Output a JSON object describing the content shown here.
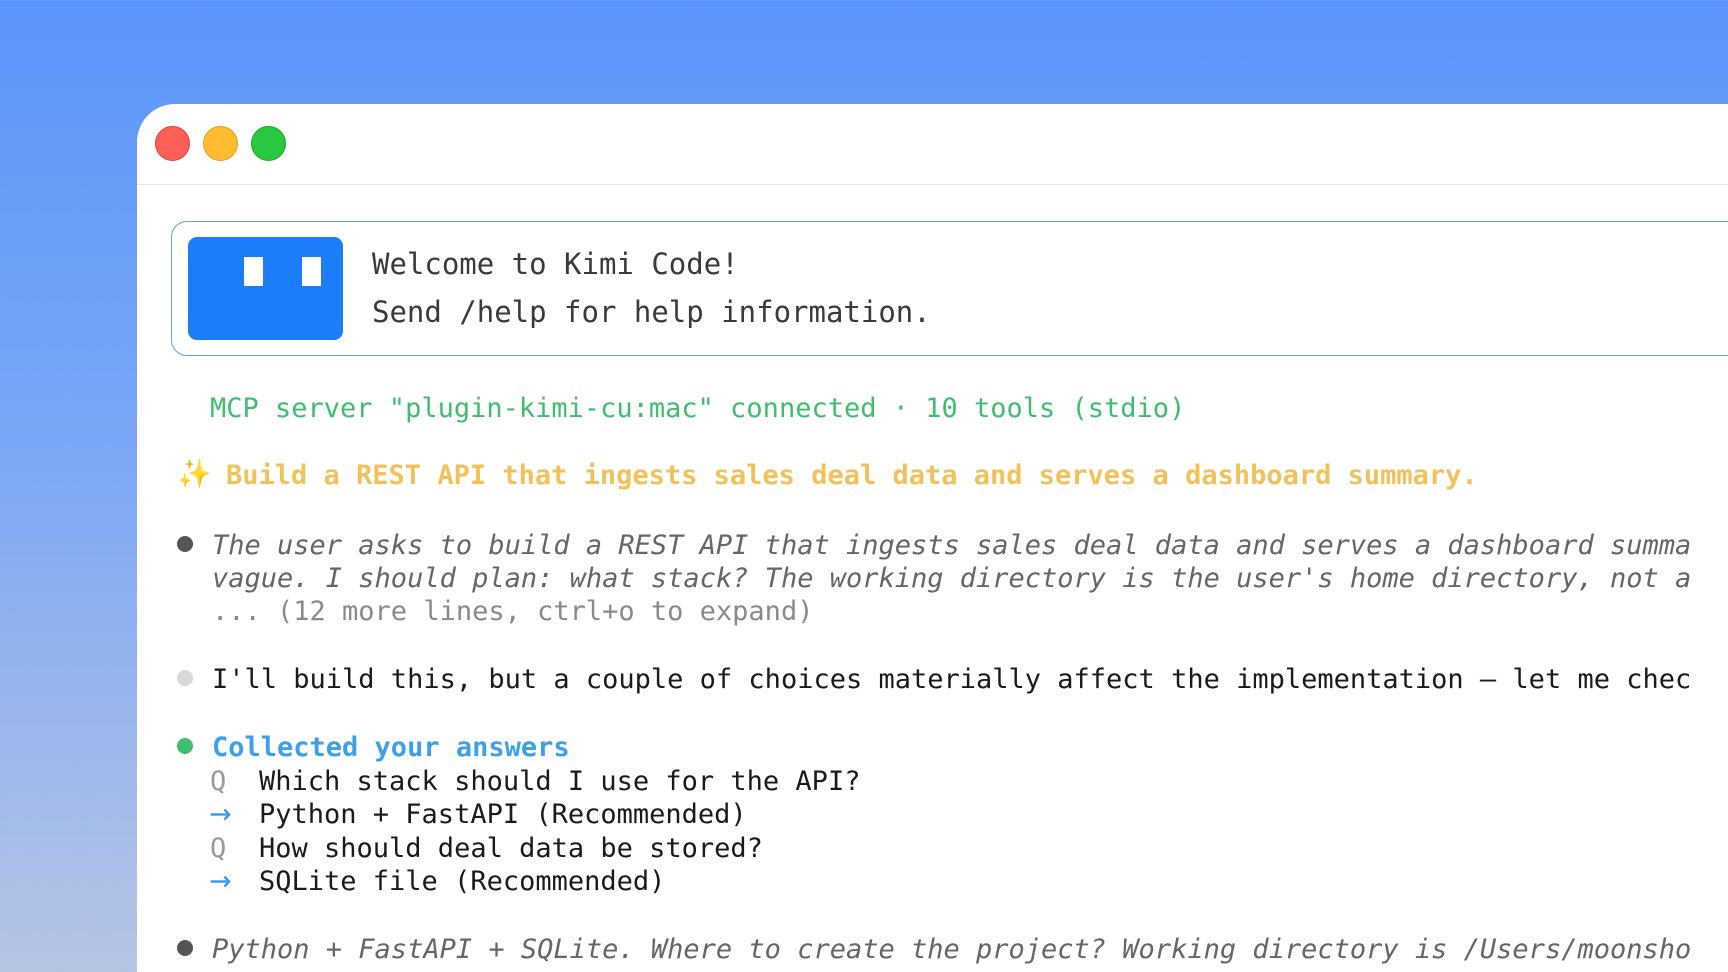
{
  "window": {
    "controls": [
      "close",
      "minimize",
      "zoom"
    ]
  },
  "welcome": {
    "line1": "Welcome to Kimi Code!",
    "line2": "Send /help for help information."
  },
  "mcp_status": "MCP server \"plugin-kimi-cu:mac\" connected · 10 tools (stdio)",
  "prompt": {
    "icon": "✨",
    "text": "Build a REST API that ingests sales deal data and serves a dashboard summary."
  },
  "thinking": {
    "line1": "The user asks to build a REST API that ingests sales deal data and serves a dashboard summa",
    "line2": "vague. I should plan: what stack? The working directory is the user's home directory, not a",
    "more": "... (12 more lines, ctrl+o to expand)"
  },
  "reply": "I'll build this, but a couple of choices materially affect the implementation — let me chec",
  "answers": {
    "title": "Collected your answers",
    "items": [
      {
        "mark": "Q",
        "text": "Which stack should I use for the API?"
      },
      {
        "mark": "→",
        "text": "Python + FastAPI (Recommended)"
      },
      {
        "mark": "Q",
        "text": "How should deal data be stored?"
      },
      {
        "mark": "→",
        "text": "SQLite file (Recommended)"
      }
    ]
  },
  "summary": {
    "line1": "Python + FastAPI + SQLite. Where to create the project? Working directory is /Users/moonsho"
  },
  "colors": {
    "background_top": "#5a95fb",
    "logo": "#1b7df8",
    "mcp_green": "#3fbe6f",
    "prompt_yellow": "#f1c15b",
    "answers_blue": "#3ea0e8"
  }
}
